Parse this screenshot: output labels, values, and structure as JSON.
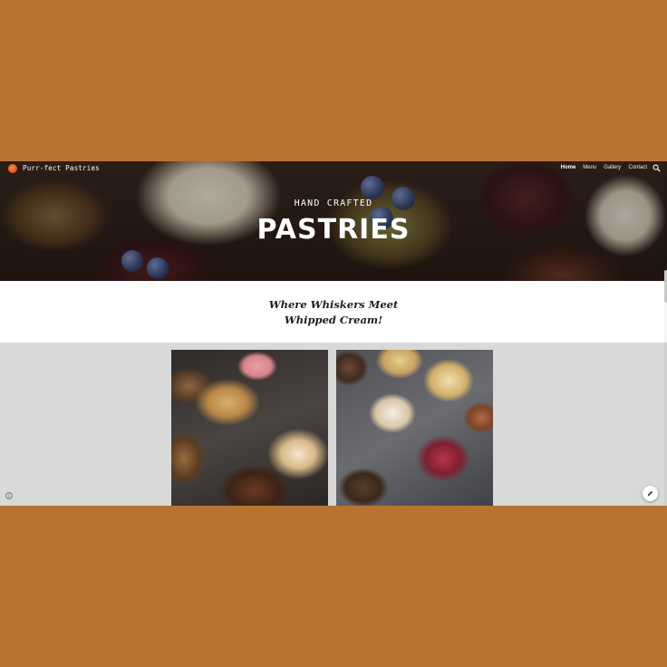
{
  "site": {
    "title": "Purr-fect Pastries",
    "nav": [
      "Home",
      "Menu",
      "Gallery",
      "Contact"
    ],
    "active_nav": "Home"
  },
  "hero": {
    "subtitle": "HAND CRAFTED",
    "title": "PASTRIES"
  },
  "tagline": "Where Whiskers Meet Whipped Cream!",
  "gallery": {
    "images": [
      {
        "alt": "cupcakes-and-macarons"
      },
      {
        "alt": "assorted-cupcakes-top-view"
      }
    ]
  },
  "icons": {
    "logo": "cat-logo-icon",
    "search": "search-icon",
    "info": "info-icon",
    "edit": "pencil-icon"
  },
  "colors": {
    "frame_background": "#b87333",
    "gallery_background": "#d9d9d9",
    "hero_text": "#ffffff"
  }
}
